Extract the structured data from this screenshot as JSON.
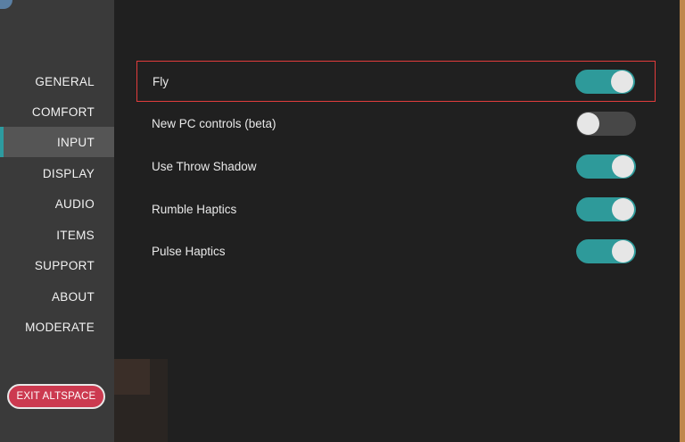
{
  "sidebar": {
    "items": [
      {
        "label": "GENERAL",
        "active": false
      },
      {
        "label": "COMFORT",
        "active": false
      },
      {
        "label": "INPUT",
        "active": true
      },
      {
        "label": "DISPLAY",
        "active": false
      },
      {
        "label": "AUDIO",
        "active": false
      },
      {
        "label": "ITEMS",
        "active": false
      },
      {
        "label": "SUPPORT",
        "active": false
      },
      {
        "label": "ABOUT",
        "active": false
      },
      {
        "label": "MODERATE",
        "active": false
      }
    ],
    "exit_label": "EXIT ALTSPACE"
  },
  "settings": [
    {
      "label": "Fly",
      "enabled": true,
      "highlighted": true
    },
    {
      "label": "New PC controls (beta)",
      "enabled": false,
      "highlighted": false
    },
    {
      "label": "Use Throw Shadow",
      "enabled": true,
      "highlighted": false
    },
    {
      "label": "Rumble Haptics",
      "enabled": true,
      "highlighted": false
    },
    {
      "label": "Pulse Haptics",
      "enabled": true,
      "highlighted": false
    }
  ],
  "colors": {
    "accent": "#2e9a9a",
    "highlight_border": "#e23c3c",
    "exit_button": "#cc3a50"
  }
}
